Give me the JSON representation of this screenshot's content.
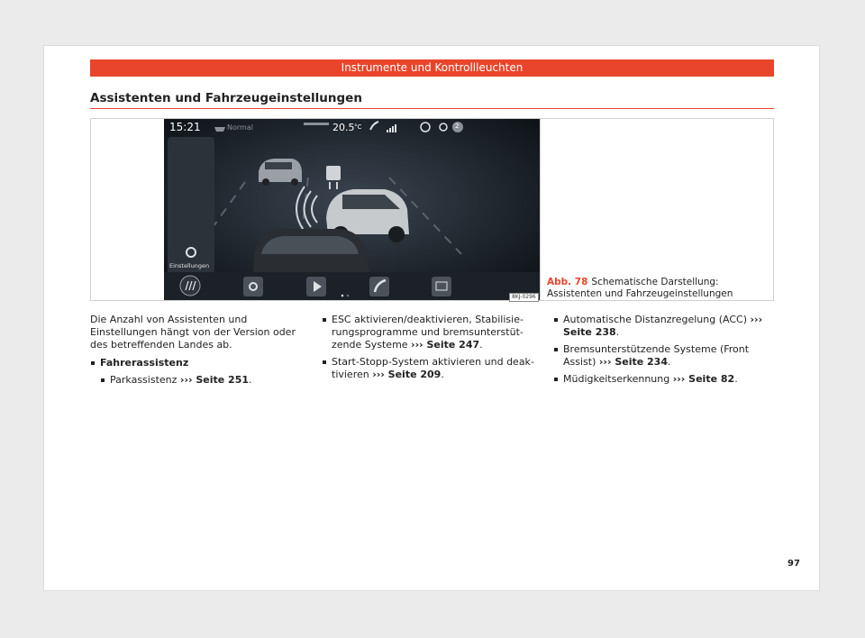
{
  "header": {
    "title": "Instrumente und Kontrollleuchten"
  },
  "section": {
    "title": "Assistenten und Fahrzeugeinstellungen"
  },
  "figure": {
    "code": "8KJ-0296",
    "caption_label": "Abb. 78",
    "caption_text": "Schematische Darstellung: Assistenten und Fahrzeugeinstellungen",
    "screen": {
      "time": "15:21",
      "mode": "Normal",
      "temperature": "20.5",
      "temp_unit": "°C",
      "notification_count": "2",
      "settings_label": "Einstellungen"
    }
  },
  "col1": {
    "intro": "Die Anzahl von Assistenten und Einstellungen hängt von der Version oder des betreffenden Landes ab.",
    "heading": "Fahrerassistenz",
    "sub_text": "Parkassistenz",
    "sub_ref": "››› Seite 251",
    "sub_end": "."
  },
  "col2": {
    "items": [
      {
        "text": "ESC aktivieren/deaktivieren, Stabilisie­rungsprogramme und bremsunterstüt­zende Systeme",
        "ref": "››› Seite 247",
        "end": "."
      },
      {
        "text": "Start-Stopp-System aktivieren und deak­tivieren",
        "ref": "››› Seite 209",
        "end": "."
      }
    ]
  },
  "col3": {
    "items": [
      {
        "text": "Automatische Distanzregelung (ACC)",
        "ref": "››› Seite 238",
        "end": "."
      },
      {
        "text": "Bremsunterstützende Systeme (Front As­sist)",
        "ref": "››› Seite 234",
        "end": "."
      },
      {
        "text": "Müdigkeitserkennung",
        "ref": "››› Seite 82",
        "end": "."
      }
    ]
  },
  "page": {
    "number": "97"
  },
  "colors": {
    "accent": "#e9452a",
    "screen_bg": "#101419"
  }
}
